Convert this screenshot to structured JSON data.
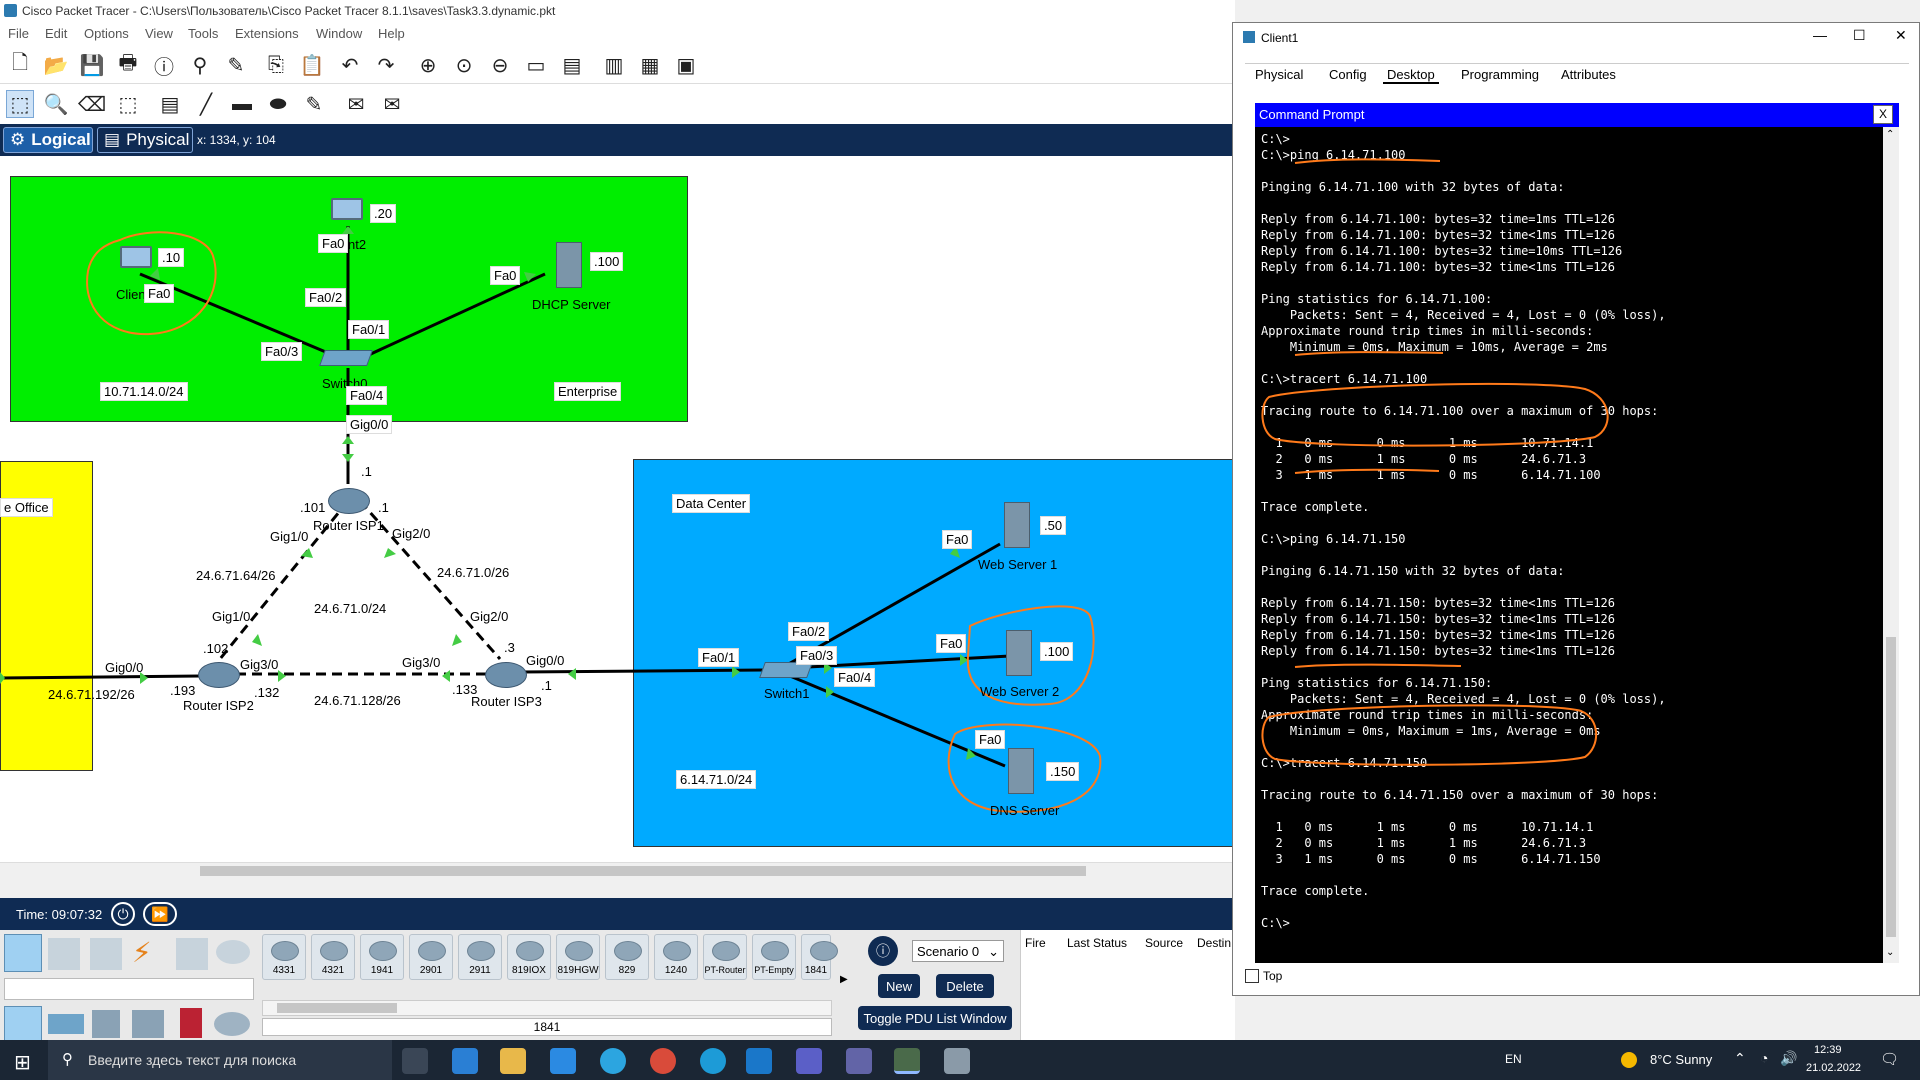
{
  "window": {
    "title": "Cisco Packet Tracer - C:\\Users\\Пользователь\\Cisco Packet Tracer 8.1.1\\saves\\Task3.3.dynamic.pkt"
  },
  "menu": [
    "File",
    "Edit",
    "Options",
    "View",
    "Tools",
    "Extensions",
    "Window",
    "Help"
  ],
  "viewbar": {
    "logical": "Logical",
    "physical": "Physical",
    "coords": "x: 1334, y: 104"
  },
  "topology": {
    "enterprise": {
      "network": "10.71.14.0/24",
      "name": "Enterprise",
      "client_ip": ".10",
      "client_name": "Clien",
      "client_port": "Fa0",
      "client2_ip": ".20",
      "client2_name": "nt2",
      "client2_port": "Fa0",
      "dhcp_ip": ".100",
      "dhcp_name": "DHCP Server",
      "dhcp_port": "Fa0",
      "sw_fa02": "Fa0/2",
      "sw_fa01": "Fa0/1",
      "sw_fa03": "Fa0/3",
      "sw_fa04": "Fa0/4",
      "switch_name": "Switch0"
    },
    "isp1": {
      "name": "Router ISP1",
      "gig00": "Gig0/0",
      "ip_top": ".1",
      "ip_left": ".101",
      "ip_right": ".1",
      "gig10": "Gig1/0",
      "gig20": "Gig2/0"
    },
    "isp2": {
      "name": "Router ISP2",
      "gig10": "Gig1/0",
      "ip_102": ".102",
      "gig30": "Gig3/0",
      "gig00": "Gig0/0",
      "ip_193": ".193",
      "ip_132": ".132"
    },
    "isp3": {
      "name": "Router ISP3",
      "gig20": "Gig2/0",
      "ip_3": ".3",
      "gig30": "Gig3/0",
      "gig00": "Gig0/0",
      "ip_133": ".133",
      "ip_1": ".1"
    },
    "links": {
      "l1": "24.6.71.64/26",
      "l2": "24.6.71.0/24",
      "l3": "24.6.71.0/26",
      "l4": "24.6.71.192/26",
      "l5": "24.6.71.128/26"
    },
    "office": "e Office",
    "datacenter": {
      "name": "Data Center",
      "network": "6.14.71.0/24",
      "ws1_ip": ".50",
      "ws1_name": "Web Server 1",
      "ws1_port": "Fa0",
      "ws2_ip": ".100",
      "ws2_name": "Web Server 2",
      "ws2_port": "Fa0",
      "dns_ip": ".150",
      "dns_name": "DNS Server",
      "dns_port": "Fa0",
      "sw_fa01": "Fa0/1",
      "sw_fa02": "Fa0/2",
      "sw_fa03": "Fa0/3",
      "sw_fa04": "Fa0/4",
      "switch_name": "Switch1"
    }
  },
  "timebar": {
    "time": "Time: 09:07:32"
  },
  "devices": [
    "4331",
    "4321",
    "1941",
    "2901",
    "2911",
    "819IOX",
    "819HGW",
    "829",
    "1240",
    "PT-Router",
    "PT-Empty",
    "1841"
  ],
  "selected_device": "1841",
  "scenario": {
    "value": "Scenario 0",
    "new": "New",
    "delete": "Delete",
    "toggle": "Toggle PDU List Window"
  },
  "pdu_headers": [
    "Fire",
    "Last Status",
    "Source",
    "Destin"
  ],
  "client": {
    "title": "Client1",
    "tabs": [
      "Physical",
      "Config",
      "Desktop",
      "Programming",
      "Attributes"
    ],
    "active_tab": "Desktop",
    "cmd_title": "Command Prompt",
    "close": "X",
    "top_label": "Top",
    "output": "C:\\>\nC:\\>ping 6.14.71.100\n\nPinging 6.14.71.100 with 32 bytes of data:\n\nReply from 6.14.71.100: bytes=32 time=1ms TTL=126\nReply from 6.14.71.100: bytes=32 time<1ms TTL=126\nReply from 6.14.71.100: bytes=32 time=10ms TTL=126\nReply from 6.14.71.100: bytes=32 time<1ms TTL=126\n\nPing statistics for 6.14.71.100:\n    Packets: Sent = 4, Received = 4, Lost = 0 (0% loss),\nApproximate round trip times in milli-seconds:\n    Minimum = 0ms, Maximum = 10ms, Average = 2ms\n\nC:\\>tracert 6.14.71.100\n\nTracing route to 6.14.71.100 over a maximum of 30 hops:\n\n  1   0 ms      0 ms      1 ms      10.71.14.1\n  2   0 ms      1 ms      0 ms      24.6.71.3\n  3   1 ms      1 ms      0 ms      6.14.71.100\n\nTrace complete.\n\nC:\\>ping 6.14.71.150\n\nPinging 6.14.71.150 with 32 bytes of data:\n\nReply from 6.14.71.150: bytes=32 time<1ms TTL=126\nReply from 6.14.71.150: bytes=32 time<1ms TTL=126\nReply from 6.14.71.150: bytes=32 time<1ms TTL=126\nReply from 6.14.71.150: bytes=32 time<1ms TTL=126\n\nPing statistics for 6.14.71.150:\n    Packets: Sent = 4, Received = 4, Lost = 0 (0% loss),\nApproximate round trip times in milli-seconds:\n    Minimum = 0ms, Maximum = 1ms, Average = 0ms\n\nC:\\>tracert 6.14.71.150\n\nTracing route to 6.14.71.150 over a maximum of 30 hops:\n\n  1   0 ms      1 ms      0 ms      10.71.14.1\n  2   0 ms      1 ms      1 ms      24.6.71.3\n  3   1 ms      0 ms      0 ms      6.14.71.150\n\nTrace complete.\n\nC:\\>"
  },
  "taskbar": {
    "search_placeholder": "Введите здесь текст для поиска",
    "lang": "EN",
    "weather": "8°C  Sunny",
    "time": "12:39",
    "date": "21.02.2022"
  },
  "colors": {
    "enterprise": "#00ee00",
    "datacenter": "#00aaff",
    "office": "#ffff00",
    "annotation": "#ff7a1a",
    "navy": "#0f2b53"
  }
}
